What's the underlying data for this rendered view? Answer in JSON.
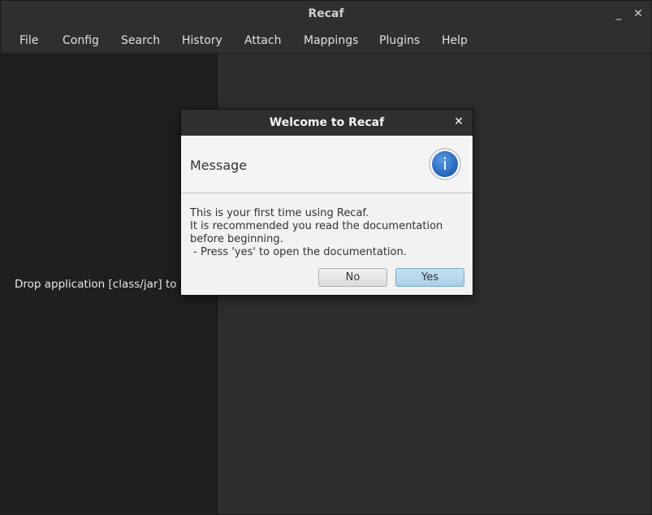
{
  "window": {
    "title": "Recaf",
    "minimize_glyph": "_",
    "close_glyph": "✕"
  },
  "menu": {
    "items": [
      "File",
      "Config",
      "Search",
      "History",
      "Attach",
      "Mappings",
      "Plugins",
      "Help"
    ]
  },
  "left_panel": {
    "drop_text": "Drop application [class/jar] to b"
  },
  "dialog": {
    "title": "Welcome to Recaf",
    "close_glyph": "✕",
    "header": "Message",
    "icon_glyph": "i",
    "body_lines": [
      "This is your first time using Recaf.",
      "It is recommended you read the documentation",
      "before beginning.",
      " - Press 'yes' to open the documentation."
    ],
    "no_label": "No",
    "yes_label": "Yes"
  },
  "colors": {
    "accent_info": "#2b6fc6",
    "yes_button": "#a9cfe8"
  }
}
